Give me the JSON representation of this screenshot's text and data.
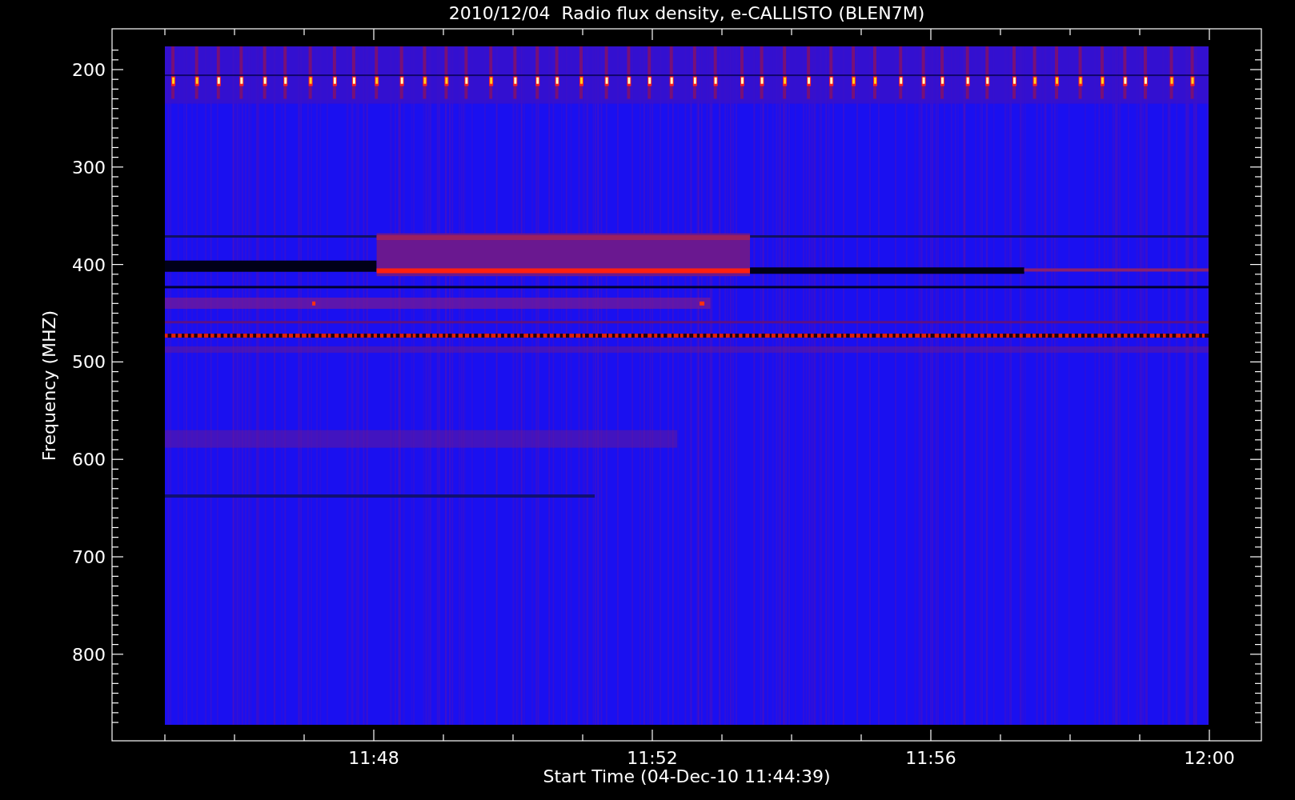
{
  "plot": {
    "title": "2010/12/04  Radio flux density, e-CALLISTO (BLEN7M)",
    "xlabel": "Start Time (04-Dec-10 11:44:39)",
    "ylabel": "Frequency (MHZ)",
    "y_tick_labels": [
      "200",
      "300",
      "400",
      "500",
      "600",
      "700",
      "800"
    ],
    "x_tick_labels": [
      "11:48",
      "11:52",
      "11:56",
      "12:00"
    ]
  }
}
